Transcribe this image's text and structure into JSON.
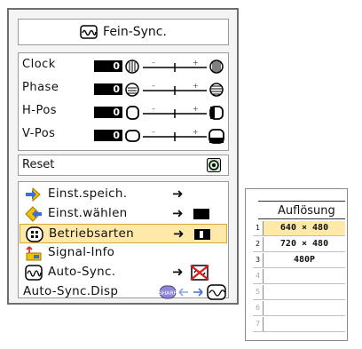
{
  "menu": {
    "title": "Fein-Sync.",
    "adjustments": [
      {
        "label": "Clock",
        "value": "0"
      },
      {
        "label": "Phase",
        "value": "0"
      },
      {
        "label": "H-Pos",
        "value": "0"
      },
      {
        "label": "V-Pos",
        "value": "0"
      }
    ],
    "reset_label": "Reset",
    "options": [
      {
        "label": "Einst.speich."
      },
      {
        "label": "Einst.wählen"
      },
      {
        "label": "Betriebsarten",
        "selected": true
      },
      {
        "label": "Signal-Info"
      },
      {
        "label": "Auto-Sync."
      },
      {
        "label": "Auto-Sync.Disp"
      }
    ],
    "arrow_glyph": "➜"
  },
  "resolution_table": {
    "header": "Auflösung",
    "rows": [
      {
        "num": "1",
        "value": "640 × 480",
        "selected": true
      },
      {
        "num": "2",
        "value": "720 × 480"
      },
      {
        "num": "3",
        "value": "480P"
      },
      {
        "num": "4",
        "value": ""
      },
      {
        "num": "5",
        "value": ""
      },
      {
        "num": "6",
        "value": ""
      },
      {
        "num": "7",
        "value": ""
      }
    ]
  },
  "colors": {
    "selected_highlight": "#ffe9a8",
    "icon_yellow": "#f2c200",
    "icon_blue": "#3b6fd8",
    "icon_red": "#d82020"
  }
}
